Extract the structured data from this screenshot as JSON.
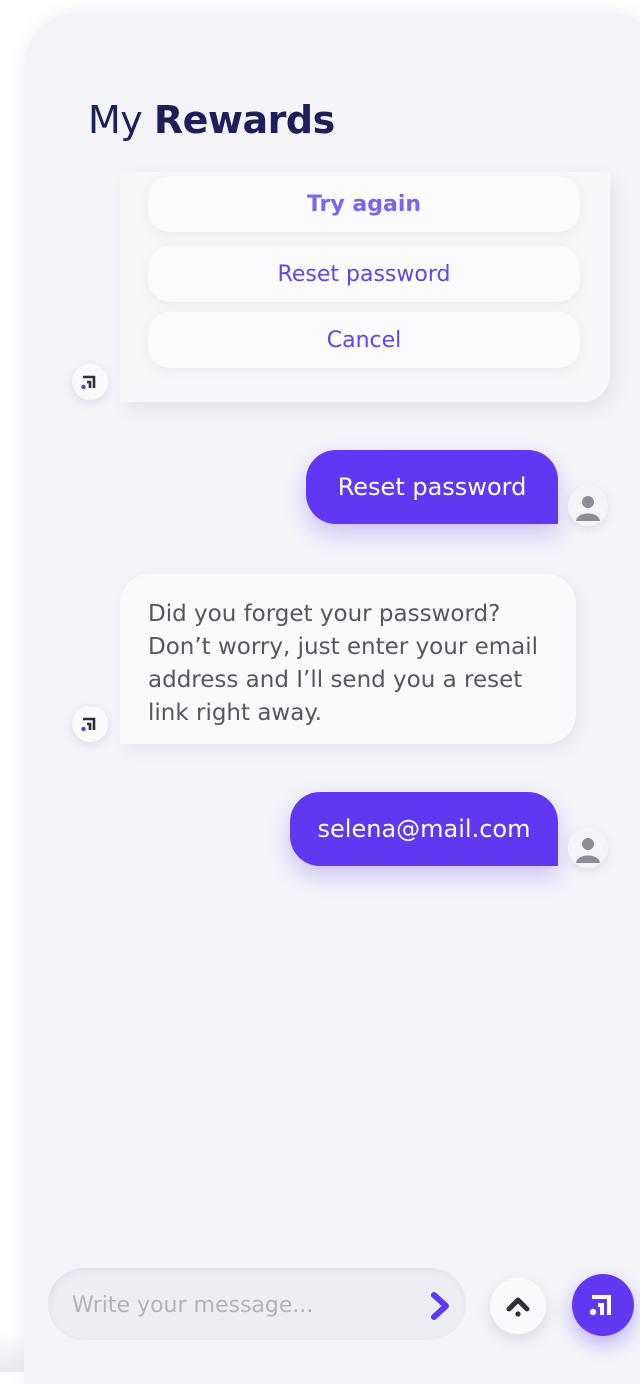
{
  "header": {
    "title_prefix": "My",
    "title_strong": "Rewards"
  },
  "options": [
    {
      "label": "Try again"
    },
    {
      "label": "Reset password"
    },
    {
      "label": "Cancel"
    }
  ],
  "messages": [
    {
      "from": "user",
      "text": "Reset password"
    },
    {
      "from": "bot",
      "text": "Did you forget your password? Don’t worry, just enter your email address and I’ll send you a reset link right away."
    },
    {
      "from": "user",
      "text": "selena@mail.com"
    }
  ],
  "composer": {
    "placeholder": "Write your message..."
  },
  "icons": {
    "bot": "bot-logo-icon",
    "user": "user-avatar-icon",
    "send": "chevron-right-icon",
    "scroll_up": "arrow-up-icon",
    "brand": "brand-logo-icon"
  },
  "colors": {
    "accent": "#6138f2",
    "title": "#1d1f5b",
    "background": "#f3f3f8",
    "option_text": "#6344e9"
  }
}
